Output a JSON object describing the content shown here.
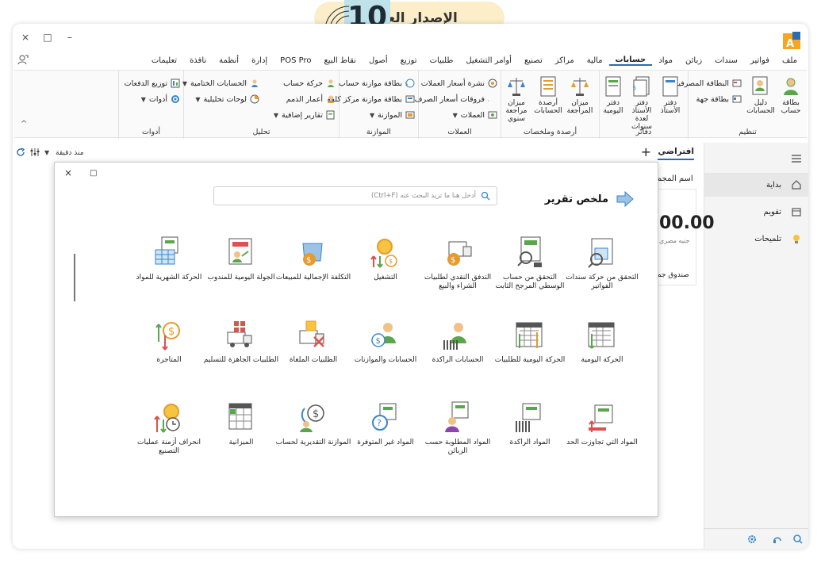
{
  "badge": {
    "text": "الإصدار العاشر",
    "number": "10"
  },
  "window": {
    "controls": [
      "×",
      "□",
      "–"
    ]
  },
  "menu": [
    "ملف",
    "فواتير",
    "سندات",
    "زبائن",
    "مواد",
    "حسابات",
    "مالية",
    "مراكز",
    "تصنيع",
    "أوامر التشغيل",
    "طلبيات",
    "توزيع",
    "أصول",
    "نقاط البيع",
    "POS Pro",
    "إدارة",
    "أنظمة",
    "نافذة",
    "تعليمات"
  ],
  "menu_active": "حسابات",
  "ribbon": {
    "groups": {
      "tanzim": "تنظيم",
      "dafater": "دفاتر",
      "arsida": "أرصدة وملخصات",
      "umlat": "العملات",
      "muwazana": "الموازنة",
      "tahlil": "تحليل",
      "adawat": "أدوات"
    },
    "tanzim": {
      "big1": "بطاقة حساب",
      "big2": "دليل الحسابات",
      "small1": "البطاقة المصرفية",
      "small2": "بطاقة جهة"
    },
    "dafater": {
      "b1": "دفتر الأستاذ",
      "b2": "دفتر الأستاذ لعدة سنوات",
      "b3": "دفتر اليومية"
    },
    "arsida": {
      "b1": "ميزان المراجعة",
      "b2": "أرصدة الحسابات",
      "b3": "ميزان مراجعة سنوي"
    },
    "umlat": {
      "s1": "نشرة أسعار العملات",
      "s2": "فروقات أسعار الصرف",
      "s3": "العملات"
    },
    "muwazana": {
      "s1": "بطاقة موازنة حساب",
      "s2": "بطاقة موازنة مركز كلفة",
      "s3": "الموازنة"
    },
    "tahlil": {
      "s1": "حركة حساب",
      "s2": "أعمار الذمم",
      "s3": "تقارير إضافية",
      "s4": "الحسابات الختامية",
      "s5": "لوحات تحليلية"
    },
    "adawat": {
      "s1": "توزيع الدفعات",
      "s2": "أدوات"
    }
  },
  "sidebar": {
    "items": [
      {
        "label": "بداية",
        "icon": "home-icon"
      },
      {
        "label": "تقويم",
        "icon": "calendar-icon"
      },
      {
        "label": "تلميحات",
        "icon": "lightbulb-icon"
      }
    ]
  },
  "tabstrip": {
    "tab": "افتراضي",
    "plus": "+",
    "since": "منذ دقيقة"
  },
  "background": {
    "title": "اسم المجم",
    "amount": "00.00",
    "currency": "جنيه مصري",
    "box": "صندوق جم"
  },
  "dialog": {
    "title": "ملخص تقرير",
    "search_placeholder": "أدخل هنا ما تريد البحث عنه (Ctrl+F)",
    "reports": [
      "التحقق من حركة سندات الفواتير",
      "التحقق من حساب الوسطي المرجح الثابت",
      "التدفق النقدي لطلبيات الشراء والبيع",
      "التشغيل",
      "التكلفة الإجمالية للمبيعات",
      "الجولة اليومية للمندوب",
      "الحركة الشهرية للمواد",
      "الحركة اليومية",
      "الحركة اليومية للطلبيات",
      "الحسابات الراكدة",
      "الحسابات والموازنات",
      "الطلبيات الملغاة",
      "الطلبيات الجاهزة للتسليم",
      "المتاجرة",
      "المواد التي تجاوزت الحد",
      "المواد الراكدة",
      "المواد المطلوبة حسب الزبائن",
      "المواد غير المتوفرة",
      "الموازنة التقديرية لحساب",
      "الميزانية",
      "انحراف أزمنة عمليات التصنيع"
    ]
  },
  "colors": {
    "accent": "#2b6cb0",
    "green": "#5aa64a",
    "orange": "#e79a2d",
    "red": "#d9534f",
    "blue": "#3a86c8"
  }
}
